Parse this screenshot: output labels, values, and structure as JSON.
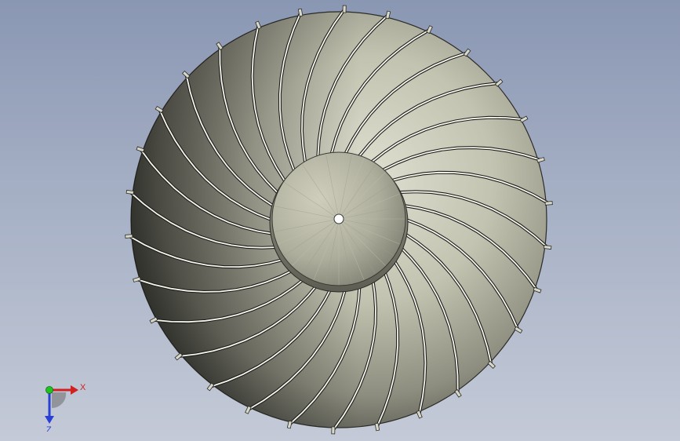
{
  "viewport": {
    "background_top": "#8a97b3",
    "background_bottom": "#c4cad7"
  },
  "model": {
    "part": "impeller",
    "blade_count": 30,
    "blade_color": "#c9c9b8",
    "hub_color": "#b8b7a6"
  },
  "triad": {
    "x_label": "X",
    "z_label": "Z",
    "x_color": "#d21f1f",
    "y_color": "#1fc41f",
    "z_color": "#2a3fd6"
  }
}
